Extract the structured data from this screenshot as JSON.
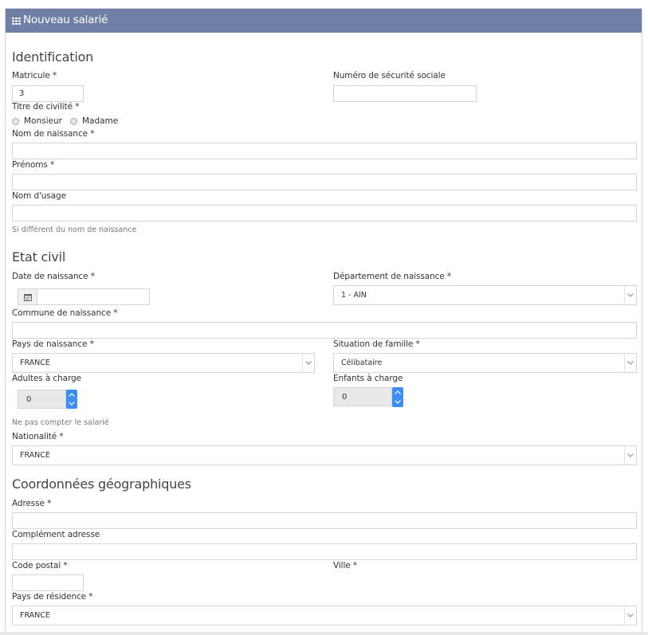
{
  "header": {
    "title": "Nouveau salarié"
  },
  "identification": {
    "section_title": "Identification",
    "matricule": {
      "label": "Matricule *",
      "value": "3"
    },
    "nss": {
      "label": "Numéro de sécurité sociale",
      "value": ""
    },
    "civilite": {
      "label": "Titre de civilité *",
      "options": [
        "Monsieur",
        "Madame"
      ]
    },
    "nom_naissance": {
      "label": "Nom de naissance *",
      "value": ""
    },
    "prenoms": {
      "label": "Prénoms *",
      "value": ""
    },
    "nom_usage": {
      "label": "Nom d'usage",
      "value": "",
      "help": "Si différent du nom de naissance"
    }
  },
  "etat_civil": {
    "section_title": "Etat civil",
    "date_naissance": {
      "label": "Date de naissance *",
      "value": ""
    },
    "departement": {
      "label": "Département de naissance *",
      "value": "1 - AIN"
    },
    "commune": {
      "label": "Commune de naissance *",
      "value": ""
    },
    "pays_naissance": {
      "label": "Pays de naissance *",
      "value": "FRANCE"
    },
    "situation": {
      "label": "Situation de famille *",
      "value": "Célibataire"
    },
    "adultes": {
      "label": "Adultes à charge",
      "value": "0",
      "help": "Ne pas compter le salarié"
    },
    "enfants": {
      "label": "Enfants à charge",
      "value": "0"
    },
    "nationalite": {
      "label": "Nationalité *",
      "value": "FRANCE"
    }
  },
  "coordonnees": {
    "section_title": "Coordonnées géographiques",
    "adresse": {
      "label": "Adresse *",
      "value": ""
    },
    "complement": {
      "label": "Complément adresse",
      "value": ""
    },
    "code_postal": {
      "label": "Code postal *",
      "value": ""
    },
    "ville": {
      "label": "Ville *",
      "value": ""
    },
    "pays_residence": {
      "label": "Pays de résidence *",
      "value": "FRANCE"
    }
  },
  "icons": {
    "header": "grid-icon",
    "date": "calendar-icon",
    "select": "chevron-down-icon",
    "spin_up": "chevron-up-icon",
    "spin_down": "chevron-down-icon"
  },
  "colors": {
    "header_bg": "#6f7fa5",
    "spinner_bg": "#3b8ef0",
    "section_text": "#444444"
  }
}
